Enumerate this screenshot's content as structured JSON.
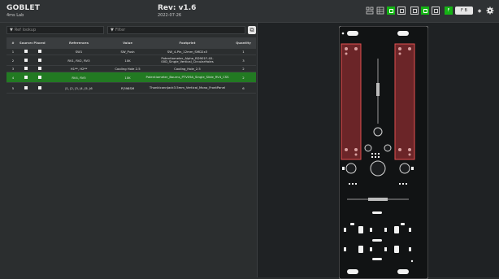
{
  "header": {
    "title": "GOBLET",
    "subtitle": "4ms Lab",
    "revision": "Rev: v1.6",
    "date": "2022-07-26"
  },
  "toolbar": {
    "icons": [
      "bom-left-icon",
      "table-icon",
      "layout-icon",
      "split-icon",
      "list-icon",
      "split-active-icon",
      "fabrication-toggle",
      "fb-toggle",
      "dark-toggle",
      "settings-icon"
    ],
    "fb_label": "F B",
    "accent": "#15b315"
  },
  "filters": {
    "ref_placeholder": "Ref lookup",
    "filter_placeholder": "Filter"
  },
  "table": {
    "columns": [
      "#",
      "Sourced",
      "Placed",
      "References",
      "Value",
      "Footprint",
      "Quantity"
    ],
    "rows": [
      {
        "n": "1",
        "refs": "SW1",
        "value": "SW_Push",
        "footprint": "SW_4-Pin_12mm_SMD2x3",
        "qty": "1"
      },
      {
        "n": "2",
        "refs": "RV1, RV2, RV3",
        "value": "10K",
        "footprint": "Potentiometer_Alpha_RD901F-40-00D_Single_Vertical_CircularHoles",
        "qty": "3"
      },
      {
        "n": "3",
        "refs": "H1**, H2**",
        "value": "Cooling Hole 2.5",
        "footprint": "Cooling_Hole_2.5",
        "qty": "2"
      },
      {
        "n": "4",
        "refs": "RV4, RV5",
        "value": "10K",
        "footprint": "Potentiometer_Bourns_PTV09A_Single_Slide_RV4_CSS",
        "qty": "2"
      },
      {
        "n": "5",
        "refs": "J1, J2, J3, J4, J5, J6",
        "value": "Pj398SM",
        "footprint": "ThonkiconnJack3.5mm_Vertical_Mono_FrontPanel",
        "qty": "6"
      }
    ],
    "selected_row": 3
  }
}
